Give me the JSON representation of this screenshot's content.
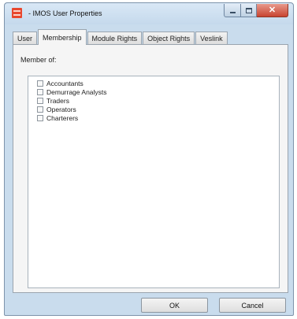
{
  "window": {
    "title": "- IMOS User Properties"
  },
  "tabs": [
    {
      "label": "User"
    },
    {
      "label": "Membership"
    },
    {
      "label": "Module Rights"
    },
    {
      "label": "Object Rights"
    },
    {
      "label": "Veslink"
    }
  ],
  "active_tab": "Membership",
  "membership": {
    "label": "Member of:",
    "groups": [
      {
        "label": "Accountants",
        "checked": false
      },
      {
        "label": "Demurrage Analysts",
        "checked": false
      },
      {
        "label": "Traders",
        "checked": false
      },
      {
        "label": "Operators",
        "checked": false
      },
      {
        "label": "Charterers",
        "checked": false
      }
    ]
  },
  "buttons": {
    "ok": "OK",
    "cancel": "Cancel"
  },
  "colors": {
    "frame": "#c9dced",
    "close_button": "#c84431",
    "app_icon": "#e8472e"
  },
  "icons": {
    "app": "imos-app-icon",
    "minimize": "minimize-icon",
    "maximize": "maximize-icon",
    "close": "close-icon"
  }
}
